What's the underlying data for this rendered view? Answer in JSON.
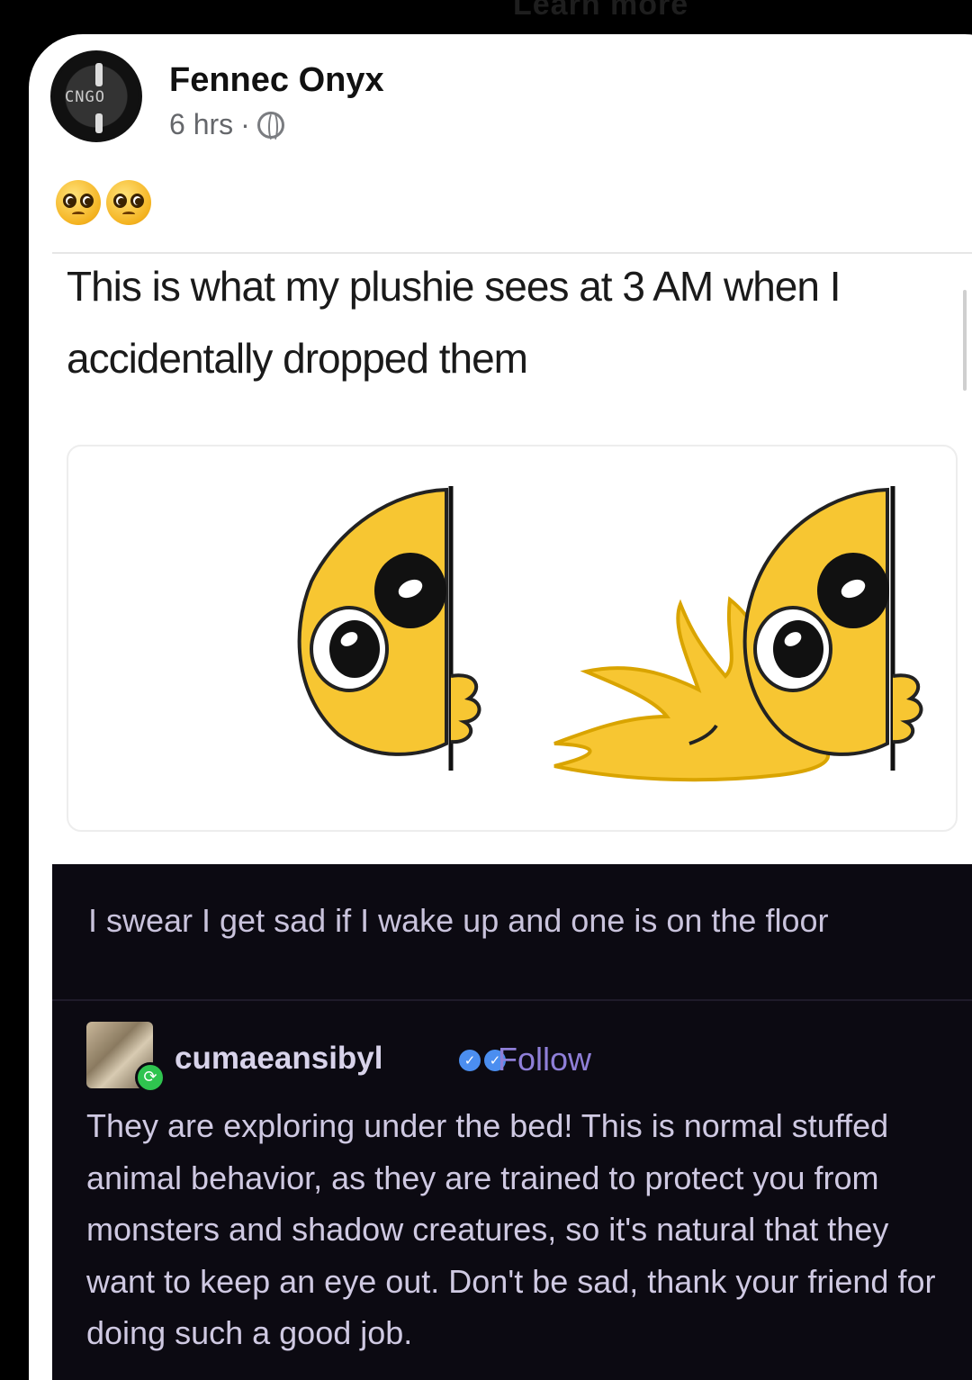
{
  "top_bar": {
    "ghost_text": "Learn more"
  },
  "post": {
    "author": "Fennec Onyx",
    "time": "6 hrs",
    "separator": "·",
    "avatar_logo_text": "CNGO",
    "emojis": [
      "pleading-face",
      "pleading-face"
    ]
  },
  "meme": {
    "caption": "This is what my plushie sees at 3 AM when I accidentally dropped them",
    "tumblr": {
      "original_post": "I swear I get sad if I wake up and one is on the floor",
      "reblog": {
        "username": "cumaeansibyl",
        "follow_label": "Follow",
        "text": "They are exploring under the bed! This is normal stuffed animal behavior, as they are trained to protect you from monsters and shadow creatures, so it's natural that they want to keep an eye out. Don't be sad, thank your friend for doing such a good job."
      }
    }
  },
  "colors": {
    "card_bg": "#ffffff",
    "tumblr_bg": "#0c0a12",
    "follow_link": "#8f7fd8",
    "reblog_badge": "#2fc44f",
    "verified": "#4b8ef0",
    "emoji_yellow": "#f4c430"
  }
}
